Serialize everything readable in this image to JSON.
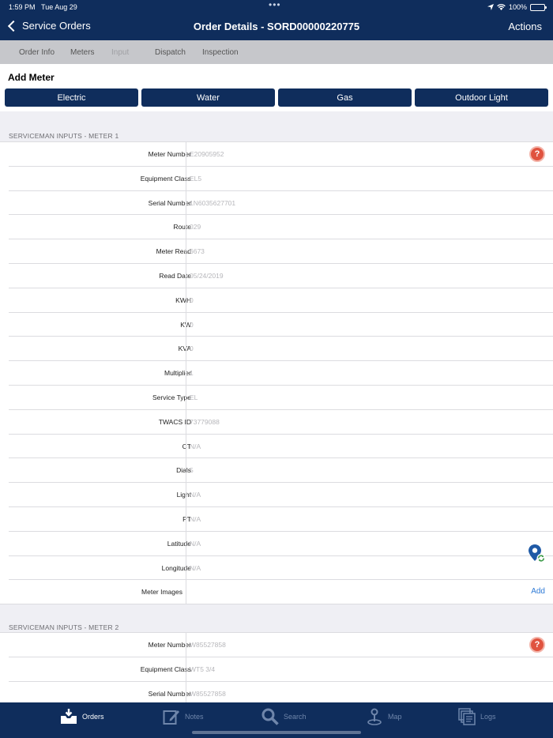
{
  "status": {
    "time": "1:59 PM",
    "date": "Tue Aug 29",
    "battery": "100%"
  },
  "nav": {
    "back_label": "Service Orders",
    "title": "Order Details - SORD00000220775",
    "actions_label": "Actions"
  },
  "tabs": [
    "Order Info",
    "Meters",
    "Input",
    "Dispatch",
    "Inspection"
  ],
  "add_meter": {
    "title": "Add Meter",
    "buttons": [
      "Electric",
      "Water",
      "Gas",
      "Outdoor Light"
    ]
  },
  "meter1": {
    "header": "SERVICEMAN INPUTS - METER 1",
    "fields": [
      {
        "label": "Meter Number",
        "value": "E20905952"
      },
      {
        "label": "Equipment Class",
        "value": "EL5"
      },
      {
        "label": "Serial Number",
        "value": "1N6035627701"
      },
      {
        "label": "Route",
        "value": "029"
      },
      {
        "label": "Meter Read",
        "value": "6673"
      },
      {
        "label": "Read Date",
        "value": "05/24/2019"
      },
      {
        "label": "KWH",
        "value": "0"
      },
      {
        "label": "KW",
        "value": "0"
      },
      {
        "label": "KVA",
        "value": "0"
      },
      {
        "label": "Multiplier",
        "value": "1"
      },
      {
        "label": "Service Type",
        "value": "EL"
      },
      {
        "label": "TWACS ID",
        "value": "73779088"
      },
      {
        "label": "CT",
        "value": "N/A"
      },
      {
        "label": "Dials",
        "value": "5"
      },
      {
        "label": "Light",
        "value": "N/A"
      },
      {
        "label": "PT",
        "value": "N/A"
      },
      {
        "label": "Latitude",
        "value": "N/A"
      },
      {
        "label": "Longitude",
        "value": "N/A"
      }
    ],
    "images_label": "Meter Images",
    "add_label": "Add"
  },
  "meter2": {
    "header": "SERVICEMAN INPUTS - METER 2",
    "fields": [
      {
        "label": "Meter Number",
        "value": "W85527858"
      },
      {
        "label": "Equipment Class",
        "value": "WT5 3/4"
      },
      {
        "label": "Serial Number",
        "value": "W85527858"
      }
    ]
  },
  "tabbar": [
    "Orders",
    "Notes",
    "Search",
    "Map",
    "Logs"
  ],
  "colors": {
    "nav": "#0f2d5c",
    "accent": "#2f7bd6",
    "alert": "#e0533f"
  }
}
